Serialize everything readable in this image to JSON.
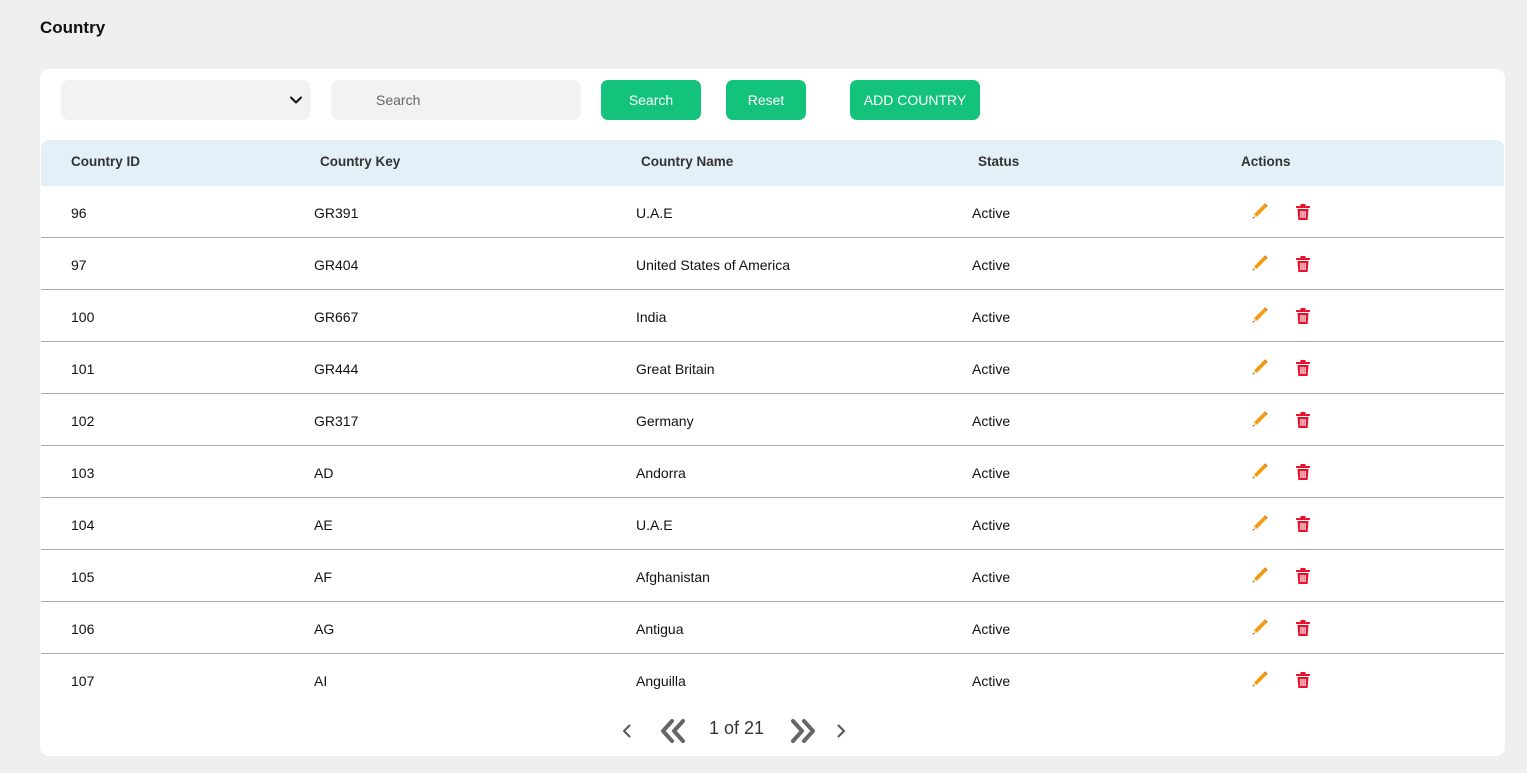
{
  "page": {
    "title": "Country"
  },
  "toolbar": {
    "select_value": "",
    "search_placeholder": "Search",
    "search_label": "Search",
    "reset_label": "Reset",
    "add_label": "ADD COUNTRY"
  },
  "table": {
    "headers": [
      "Country ID",
      "Country Key",
      "Country Name",
      "Status",
      "Actions"
    ],
    "rows": [
      {
        "id": "96",
        "key": "GR391",
        "name": "U.A.E",
        "status": "Active"
      },
      {
        "id": "97",
        "key": "GR404",
        "name": "United States of America",
        "status": "Active"
      },
      {
        "id": "100",
        "key": "GR667",
        "name": "India",
        "status": "Active"
      },
      {
        "id": "101",
        "key": "GR444",
        "name": "Great Britain",
        "status": "Active"
      },
      {
        "id": "102",
        "key": "GR317",
        "name": "Germany",
        "status": "Active"
      },
      {
        "id": "103",
        "key": "AD",
        "name": "Andorra",
        "status": "Active"
      },
      {
        "id": "104",
        "key": "AE",
        "name": "U.A.E",
        "status": "Active"
      },
      {
        "id": "105",
        "key": "AF",
        "name": "Afghanistan",
        "status": "Active"
      },
      {
        "id": "106",
        "key": "AG",
        "name": "Antigua",
        "status": "Active"
      },
      {
        "id": "107",
        "key": "AI",
        "name": "Anguilla",
        "status": "Active"
      }
    ]
  },
  "pagination": {
    "text": "1 of 21"
  },
  "colors": {
    "accent": "#13c27b",
    "header_bg": "#e3f0f8",
    "edit_icon": "#f39c12",
    "delete_icon": "#e8112d"
  },
  "icons": {
    "select": "chevron-down-icon",
    "edit": "pencil-icon",
    "delete": "trash-icon",
    "prev": "chevron-left-icon",
    "first": "double-chevron-left-icon",
    "last": "double-chevron-right-icon",
    "next": "chevron-right-icon"
  }
}
